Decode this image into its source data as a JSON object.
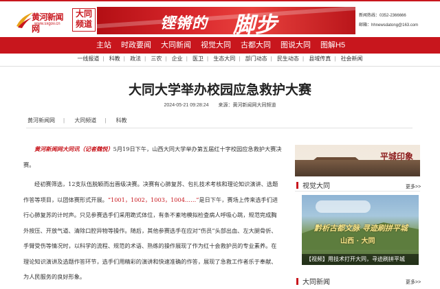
{
  "header": {
    "logo_text": "黄河新闻网",
    "logo_url": "www.sxgov.cn",
    "channel_line1": "大同",
    "channel_line2": "频道",
    "banner_text1": "铿锵的",
    "banner_text2": "脚步",
    "phone": "新闻热线：0352-2366666",
    "email": "邮箱：hhnewsdatong@163.com"
  },
  "nav": {
    "items": [
      "主站",
      "时政要闻",
      "大同新闻",
      "视觉大同",
      "古都大同",
      "图说大同",
      "图解H5"
    ]
  },
  "subnav": {
    "items": [
      "一线报道",
      "科教",
      "政法",
      "三农",
      "企业",
      "医卫",
      "生态大同",
      "部门动态",
      "民生动态",
      "县域传真",
      "社会新闻"
    ]
  },
  "article": {
    "title": "大同大学举办校园应急救护大赛",
    "datetime": "2024-05-21 09:28:24",
    "source": "来源：黄河新闻网大同频道",
    "breadcrumb": [
      "黄河新闻网",
      "大同频道",
      "科教"
    ],
    "lead_prefix": "黄河新闻网大同讯（记者魏悦）",
    "p1_rest": "5月19日下午，山西大同大学举办第五届红十字校园应急救护大赛决赛。",
    "p2_a": "经初赛筛选，12支队伍脱颖而出晋级决赛。决赛有心肺复苏、包扎技术考核和理论知识演讲、选题作答等项目，以团体赛形式开展。",
    "p2_red": "“1001，1002，1003，1004……”",
    "p2_b": "是日下午，赛场上传来选手们进行心肺复苏的计时声。只见参赛选手们采用跪式体位，有条不紊地模拟检查病人呼吸心跳，规范完成胸外按压、开放气道、清除口腔异物等操作。随后，其他参赛选手在应对“伤员”头部出血、左大腿骨折、手臂受伤等情况时，以科学的流程、规范的术语、熟练的操作展现了作为红十会救护员的专业素养。在理论知识演讲及选题作答环节，选手们用精彩的演讲和快速准确的作答，展现了急救工作者乐于奉献、为人民服务的良好形象。"
  },
  "sidebar": {
    "top_image_text": "平城印象",
    "section1_title": "视觉大同",
    "more1": "更多>>",
    "photo_title_line1": "黔析古都文脉  寻迹刷拼平城",
    "photo_title_line2": "山西 · 大同",
    "photo_caption": "【视频】用技术打开大同，寻迹刷拼平城",
    "section2_title": "大同新闻",
    "more2": "更多>>"
  },
  "colors": {
    "brand_red": "#c8161d"
  }
}
